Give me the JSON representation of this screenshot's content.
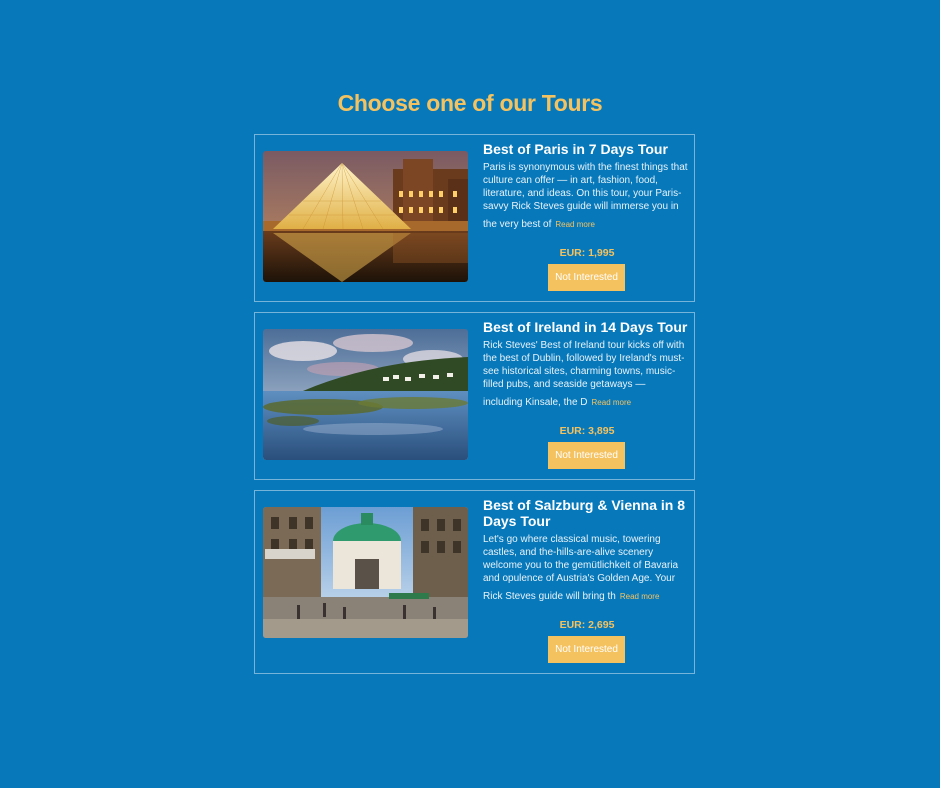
{
  "page": {
    "title": "Choose one of our Tours"
  },
  "colors": {
    "background": "#0779bb",
    "accent": "#f5c260",
    "text": "#ffffff"
  },
  "tours": [
    {
      "title": "Best of Paris in 7 Days Tour",
      "description": "Paris is synonymous with the finest things that culture can offer — in art, fashion, food, literature, and ideas. On this tour, your Paris-savvy Rick Steves guide will immerse you in",
      "description_tail": "the very best of",
      "read_more": "Read more",
      "price": "EUR: 1,995",
      "button_label": "Not Interested",
      "image_icon": "paris-louvre-image"
    },
    {
      "title": "Best of Ireland in 14 Days Tour",
      "description": "Rick Steves' Best of Ireland tour kicks off with the best of Dublin, followed by Ireland's must-see historical sites, charming towns, music-filled pubs, and seaside getaways —",
      "description_tail": "including Kinsale, the D",
      "read_more": "Read more",
      "price": "EUR: 3,895",
      "button_label": "Not Interested",
      "image_icon": "ireland-coast-image"
    },
    {
      "title": "Best of Salzburg & Vienna in 8 Days Tour",
      "description": "Let's go where classical music, towering castles, and the-hills-are-alive scenery welcome you to the gemütlichkeit of Bavaria and opulence of Austria's Golden Age. Your",
      "description_tail": "Rick Steves guide will bring th",
      "read_more": "Read more",
      "price": "EUR: 2,695",
      "button_label": "Not Interested",
      "image_icon": "vienna-street-image"
    }
  ]
}
